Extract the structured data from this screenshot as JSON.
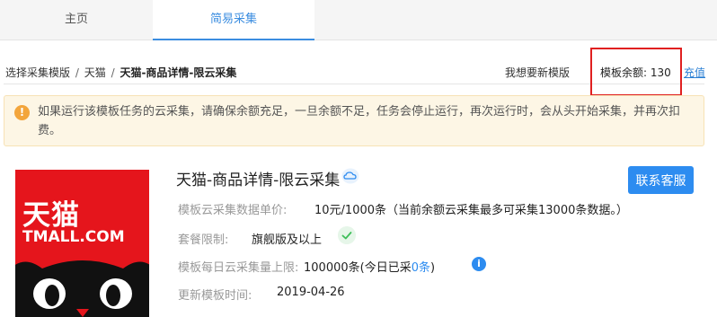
{
  "tabs": [
    {
      "label": "主页"
    },
    {
      "label": "简易采集"
    }
  ],
  "breadcrumb": {
    "root": "选择采集模版",
    "sep": "/",
    "level1": "天猫",
    "current": "天猫-商品详情-限云采集"
  },
  "header": {
    "want_new": "我想要新模版",
    "balance_label": "模板余额:",
    "balance_value": "130",
    "recharge": "充值"
  },
  "notice": {
    "icon": "exclamation-icon",
    "text": "如果运行该模板任务的云采集，请确保余额充足，一旦余额不足，任务会停止运行，再次运行时，会从头开始采集，并再次扣费。"
  },
  "logo": {
    "cn": "天猫",
    "en": "TMALL.COM"
  },
  "template": {
    "title": "天猫-商品详情-限云采集",
    "contact_button": "联系客服",
    "rows": [
      {
        "label": "模板云采集数据单价:",
        "value": "10元/1000条（当前余额云采集最多可采集13000条数据。）"
      },
      {
        "label": "套餐限制:",
        "value": "旗舰版及以上"
      },
      {
        "label": "模板每日云采集量上限:",
        "value_prefix": "100000条(今日已采",
        "value_count": "0条",
        "value_suffix": ")"
      },
      {
        "label": "更新模板时间:",
        "value": "2019-04-26"
      }
    ]
  },
  "colors": {
    "accent": "#2d8cf0",
    "tmall_red": "#e5151c",
    "highlight_border": "#e02020",
    "notice_bg": "#fdf6e5",
    "notice_icon": "#f3a53b"
  }
}
